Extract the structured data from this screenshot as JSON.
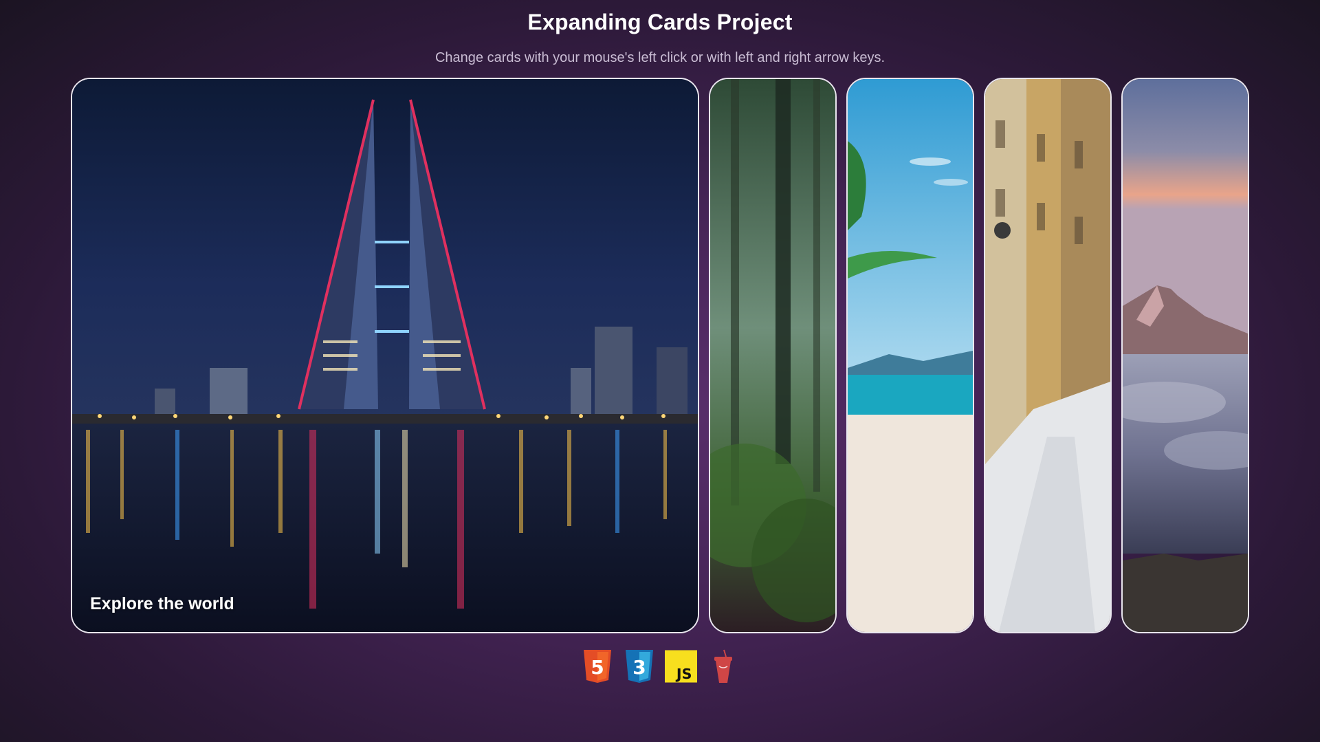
{
  "header": {
    "title": "Expanding Cards Project",
    "subtitle": "Change cards with your mouse's left click or with left and right arrow keys."
  },
  "cards": [
    {
      "label": "Explore the world",
      "scene": "night-city-twin-towers",
      "active": true
    },
    {
      "label": "",
      "scene": "forest",
      "active": false
    },
    {
      "label": "",
      "scene": "beach-palm",
      "active": false
    },
    {
      "label": "",
      "scene": "snowy-street",
      "active": false
    },
    {
      "label": "",
      "scene": "mountain-clouds",
      "active": false
    }
  ],
  "tech_icons": [
    {
      "name": "html5-icon",
      "text": "5",
      "color": "#e44d26"
    },
    {
      "name": "css3-icon",
      "text": "3",
      "color": "#2965f1"
    },
    {
      "name": "javascript-icon",
      "text": "JS",
      "color": "#f7df1e"
    },
    {
      "name": "gulp-icon",
      "text": "",
      "color": "#cf4646"
    }
  ]
}
